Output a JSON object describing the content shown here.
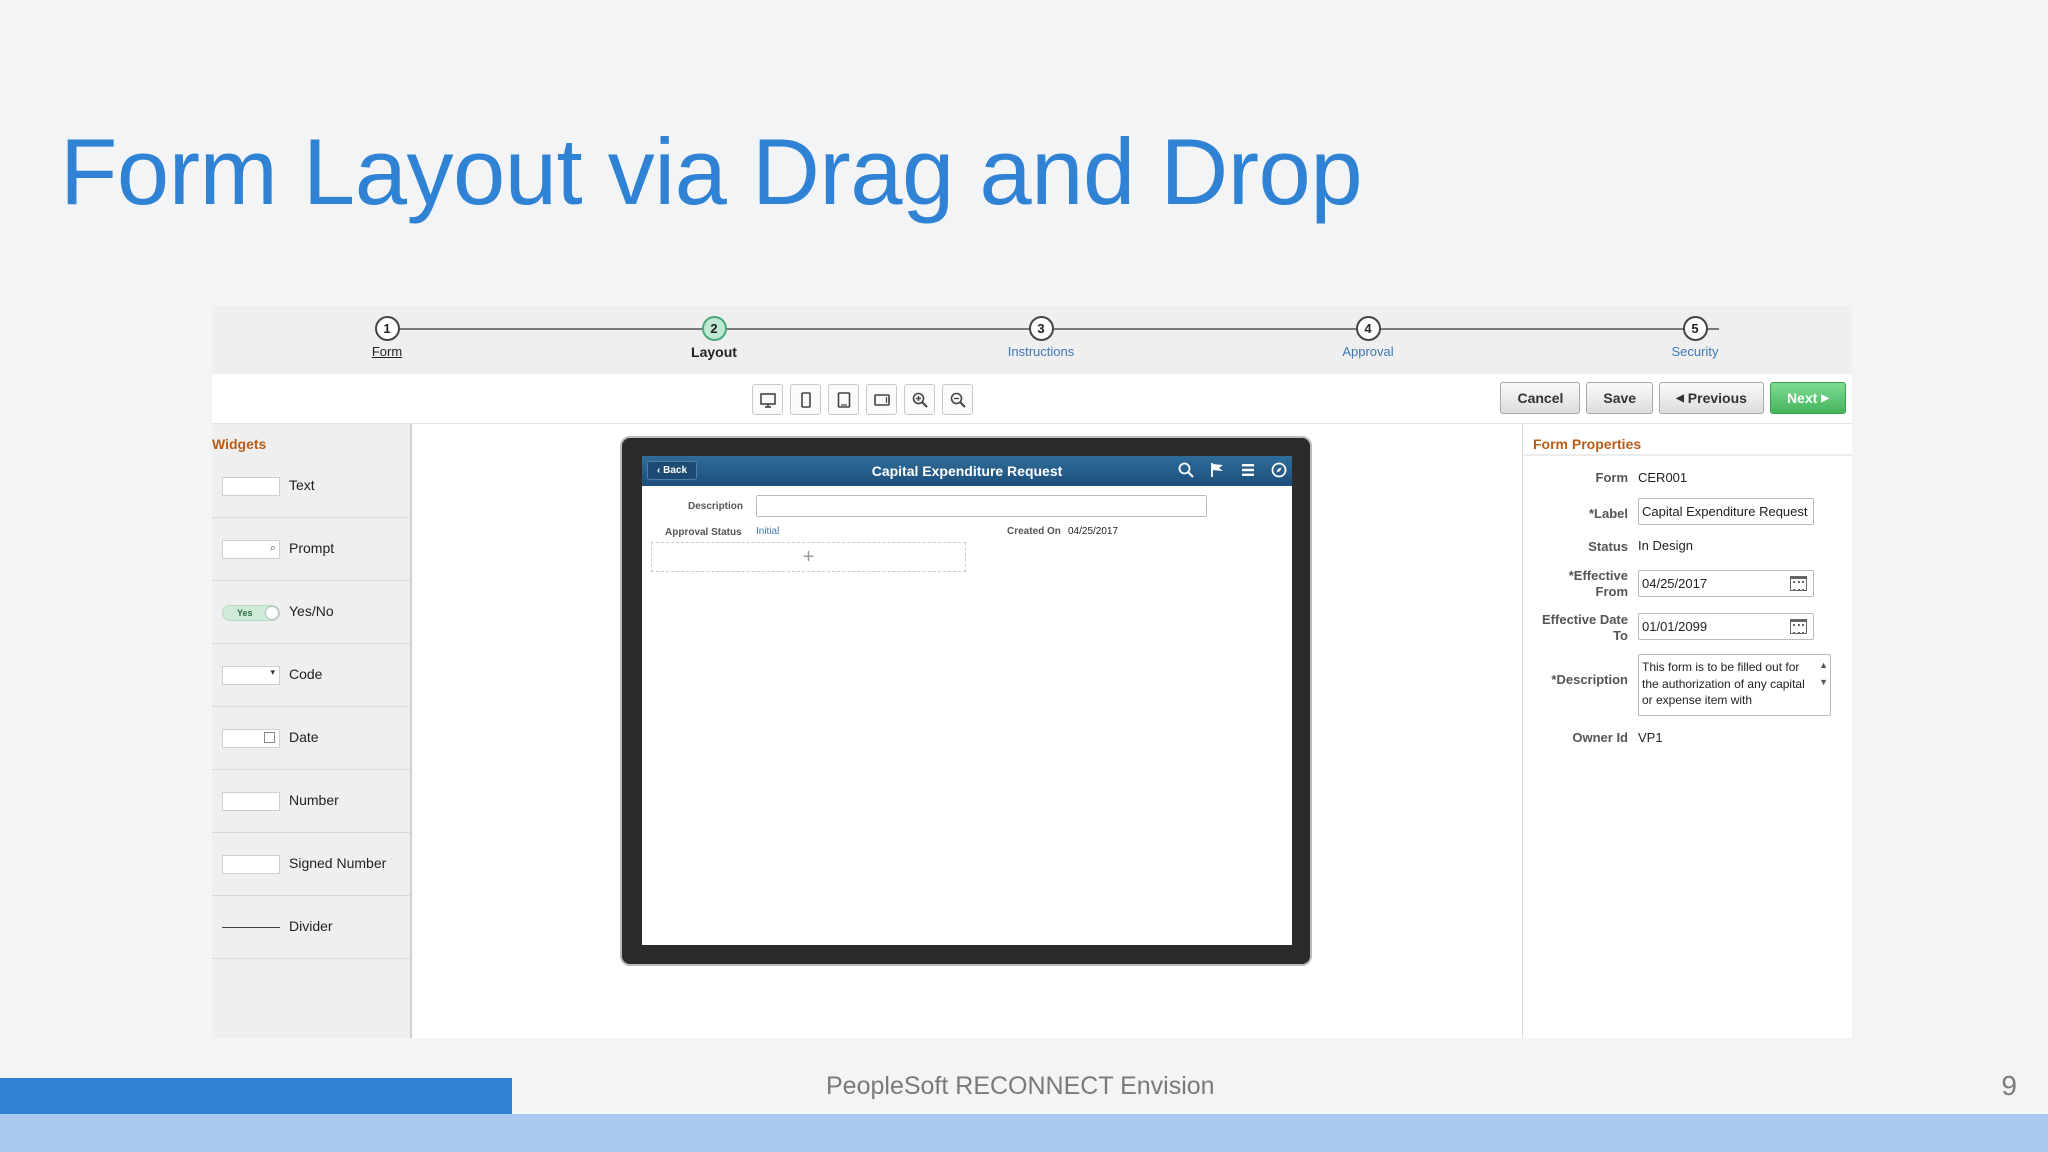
{
  "slide": {
    "title": "Form Layout via Drag and Drop",
    "footer_text": "PeopleSoft RECONNECT Envision",
    "page_number": "9"
  },
  "stepper": {
    "steps": [
      {
        "number": "1",
        "label": "Form",
        "state": "done"
      },
      {
        "number": "2",
        "label": "Layout",
        "state": "active"
      },
      {
        "number": "3",
        "label": "Instructions",
        "state": "todo"
      },
      {
        "number": "4",
        "label": "Approval",
        "state": "todo"
      },
      {
        "number": "5",
        "label": "Security",
        "state": "todo"
      }
    ]
  },
  "toolbar": {
    "icons": [
      "desktop-icon",
      "phone-portrait-icon",
      "tablet-portrait-icon",
      "tablet-landscape-icon",
      "zoom-in-icon",
      "zoom-out-icon"
    ],
    "cancel_label": "Cancel",
    "save_label": "Save",
    "previous_label": "Previous",
    "next_label": "Next"
  },
  "widgets": {
    "title": "Widgets",
    "items": [
      {
        "label": "Text",
        "icon": "text-field-icon"
      },
      {
        "label": "Prompt",
        "icon": "prompt-field-icon"
      },
      {
        "label": "Yes/No",
        "icon": "toggle-icon",
        "toggle_text": "Yes"
      },
      {
        "label": "Code",
        "icon": "dropdown-field-icon"
      },
      {
        "label": "Date",
        "icon": "date-field-icon"
      },
      {
        "label": "Number",
        "icon": "number-field-icon"
      },
      {
        "label": "Signed Number",
        "icon": "signed-number-field-icon"
      },
      {
        "label": "Divider",
        "icon": "divider-icon"
      }
    ]
  },
  "preview": {
    "back_label": "Back",
    "title": "Capital Expenditure Request",
    "icons": [
      "search-icon",
      "flag-icon",
      "menu-icon",
      "compass-icon"
    ],
    "description_label": "Description",
    "approval_status_label": "Approval Status",
    "approval_status_value": "Initial",
    "created_on_label": "Created On",
    "created_on_value": "04/25/2017",
    "drop_zone_symbol": "+"
  },
  "properties": {
    "title": "Form Properties",
    "form_label": "Form",
    "form_value": "CER001",
    "label_label": "*Label",
    "label_value": "Capital Expenditure Request",
    "status_label": "Status",
    "status_value": "In Design",
    "effective_from_label_1": "*Effective",
    "effective_from_label_2": "From",
    "effective_from_value": "04/25/2017",
    "effective_to_label_1": "Effective Date",
    "effective_to_label_2": "To",
    "effective_to_value": "01/01/2099",
    "description_label": "*Description",
    "description_value": "This form is to be filled out for the authorization of any capital or expense item with",
    "owner_label": "Owner Id",
    "owner_value": "VP1"
  }
}
